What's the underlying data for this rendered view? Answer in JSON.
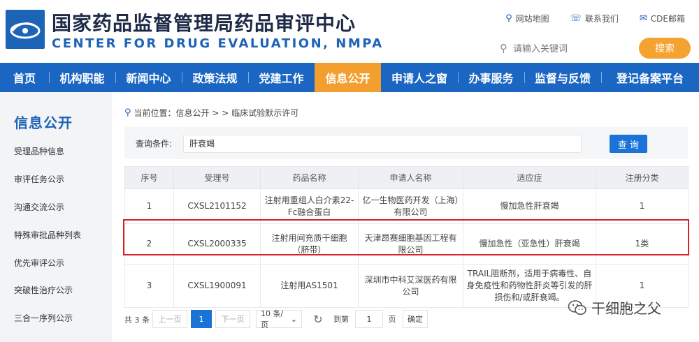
{
  "header": {
    "title_cn": "国家药品监督管理局药品审评中心",
    "title_en": "CENTER FOR DRUG EVALUATION, NMPA",
    "links": [
      {
        "icon": "map-pin-icon",
        "label": "网站地图"
      },
      {
        "icon": "phone-icon",
        "label": "联系我们"
      },
      {
        "icon": "mail-icon",
        "label": "CDE邮箱"
      }
    ],
    "search_placeholder": "请输入关键词",
    "search_button": "搜索"
  },
  "nav": {
    "items": [
      "首页",
      "机构职能",
      "新闻中心",
      "政策法规",
      "党建工作",
      "信息公开",
      "申请人之窗",
      "办事服务",
      "监督与反馈",
      "登记备案平台"
    ],
    "active": "信息公开"
  },
  "sidebar": {
    "title": "信息公开",
    "items": [
      "受理品种信息",
      "审评任务公示",
      "沟通交流公示",
      "特殊审批品种列表",
      "优先审评公示",
      "突破性治疗公示",
      "三合一序列公示"
    ]
  },
  "breadcrumb": {
    "prefix": "当前位置：信息公开 > >",
    "current": "临床试验默示许可"
  },
  "query": {
    "label": "查询条件:",
    "value": "肝衰竭",
    "button": "查 询"
  },
  "table": {
    "headers": [
      "序号",
      "受理号",
      "药品名称",
      "申请人名称",
      "适应症",
      "注册分类"
    ],
    "rows": [
      {
        "no": "1",
        "acceptance_no": "CXSL2101152",
        "drug": "注射用重组人白介素22-Fc融合蛋白",
        "applicant": "亿一生物医药开发（上海）有限公司",
        "indication": "慢加急性肝衰竭",
        "category": "1"
      },
      {
        "no": "2",
        "acceptance_no": "CXSL2000335",
        "drug": "注射用间充质干细胞（脐带）",
        "applicant": "天津昂赛细胞基因工程有限公司",
        "indication": "慢加急性（亚急性）肝衰竭",
        "category": "1类"
      },
      {
        "no": "3",
        "acceptance_no": "CXSL1900091",
        "drug": "注射用AS1501",
        "applicant": "深圳市中科艾深医药有限公司",
        "indication": "TRAIL阻断剂，适用于病毒性、自身免疫性和药物性肝炎等引发的肝损伤和/或肝衰竭。",
        "category": "1"
      }
    ],
    "highlight_row": "2"
  },
  "pager": {
    "total": "共 3 条",
    "prev": "上一页",
    "current_page": "1",
    "next": "下一页",
    "page_size": "10 条/页",
    "goto_label": "到第",
    "goto_value": "1",
    "page_unit": "页",
    "confirm": "确定"
  },
  "watermark": "干细胞之父",
  "colors": {
    "brand_blue": "#1a66c2",
    "active_orange": "#f29f2f",
    "highlight_red": "#d8202a"
  }
}
